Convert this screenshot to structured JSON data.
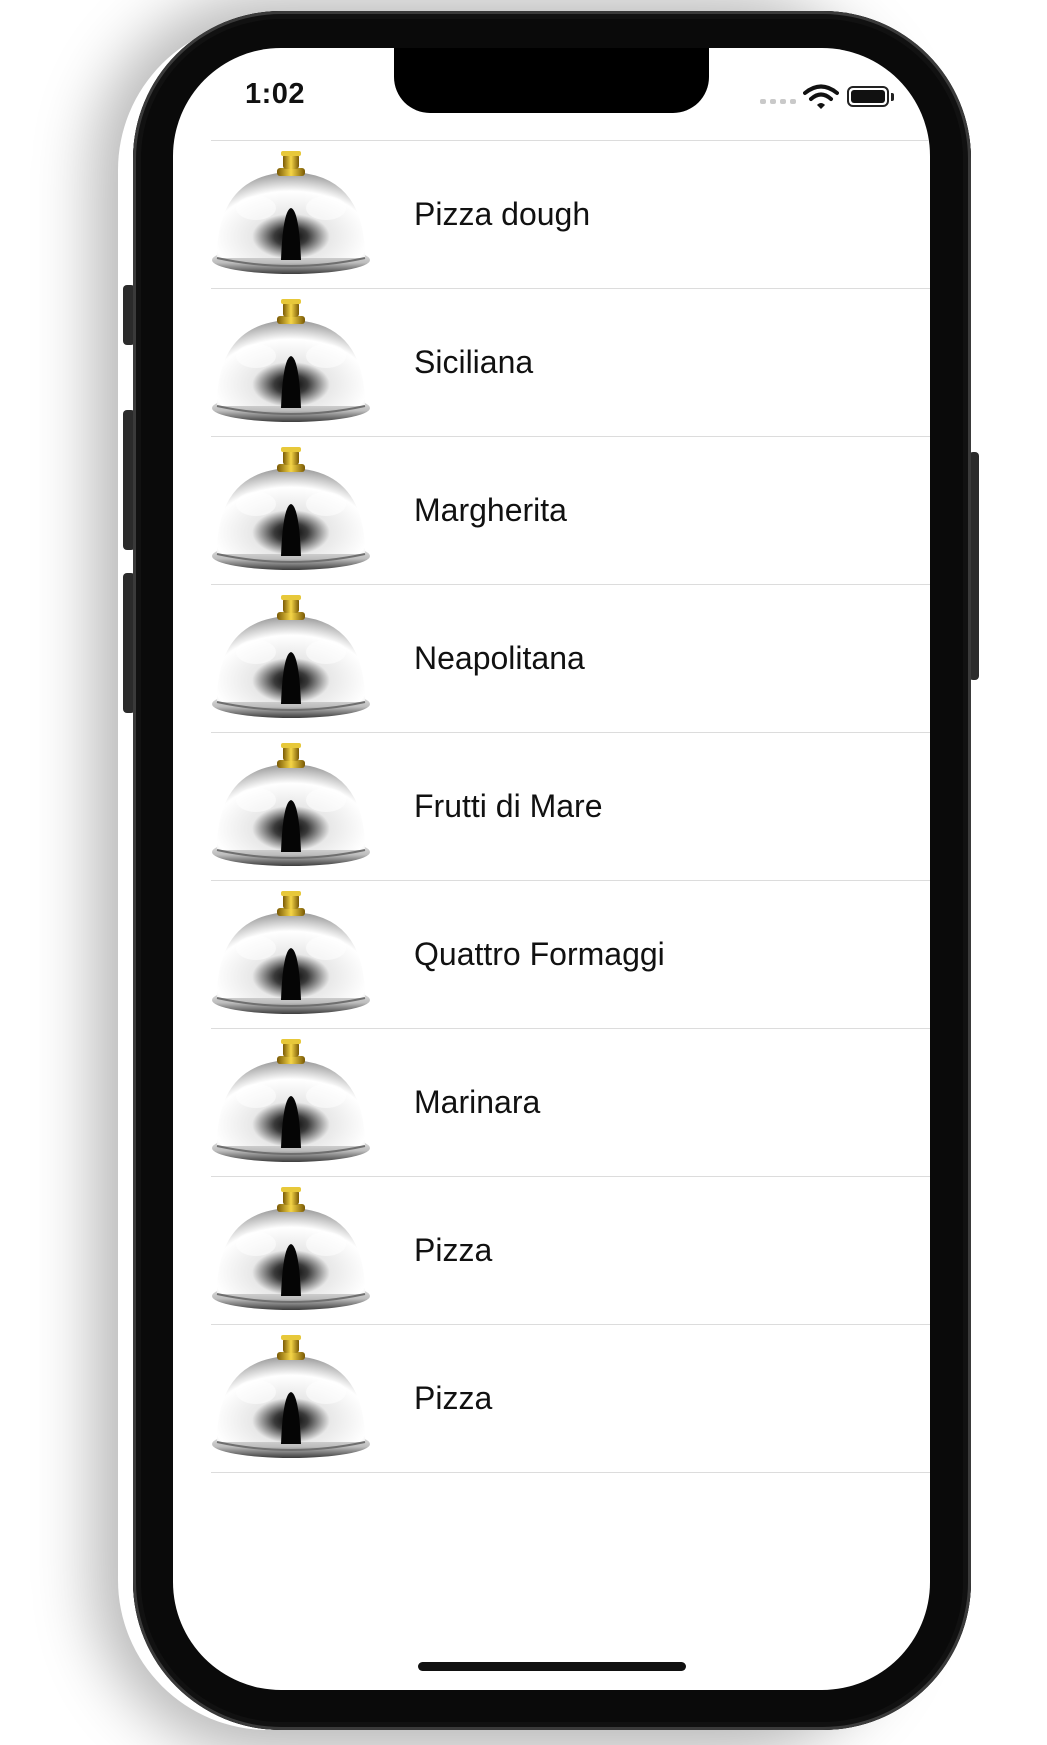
{
  "status_bar": {
    "time": "1:02",
    "icons": [
      "cellular-signal-icon",
      "wifi-icon",
      "battery-icon"
    ]
  },
  "list": {
    "thumbnail_icon": "cloche-icon",
    "items": [
      {
        "label": "Pizza dough"
      },
      {
        "label": "Siciliana"
      },
      {
        "label": "Margherita"
      },
      {
        "label": "Neapolitana"
      },
      {
        "label": "Frutti di Mare"
      },
      {
        "label": "Quattro Formaggi"
      },
      {
        "label": "Marinara"
      },
      {
        "label": "Pizza"
      },
      {
        "label": "Pizza"
      }
    ]
  },
  "colors": {
    "background": "#ffffff",
    "text": "#111111",
    "separator": "#dcdcdc",
    "device_frame": "#0a0a0a",
    "knob_gold": "#c9a21a"
  }
}
